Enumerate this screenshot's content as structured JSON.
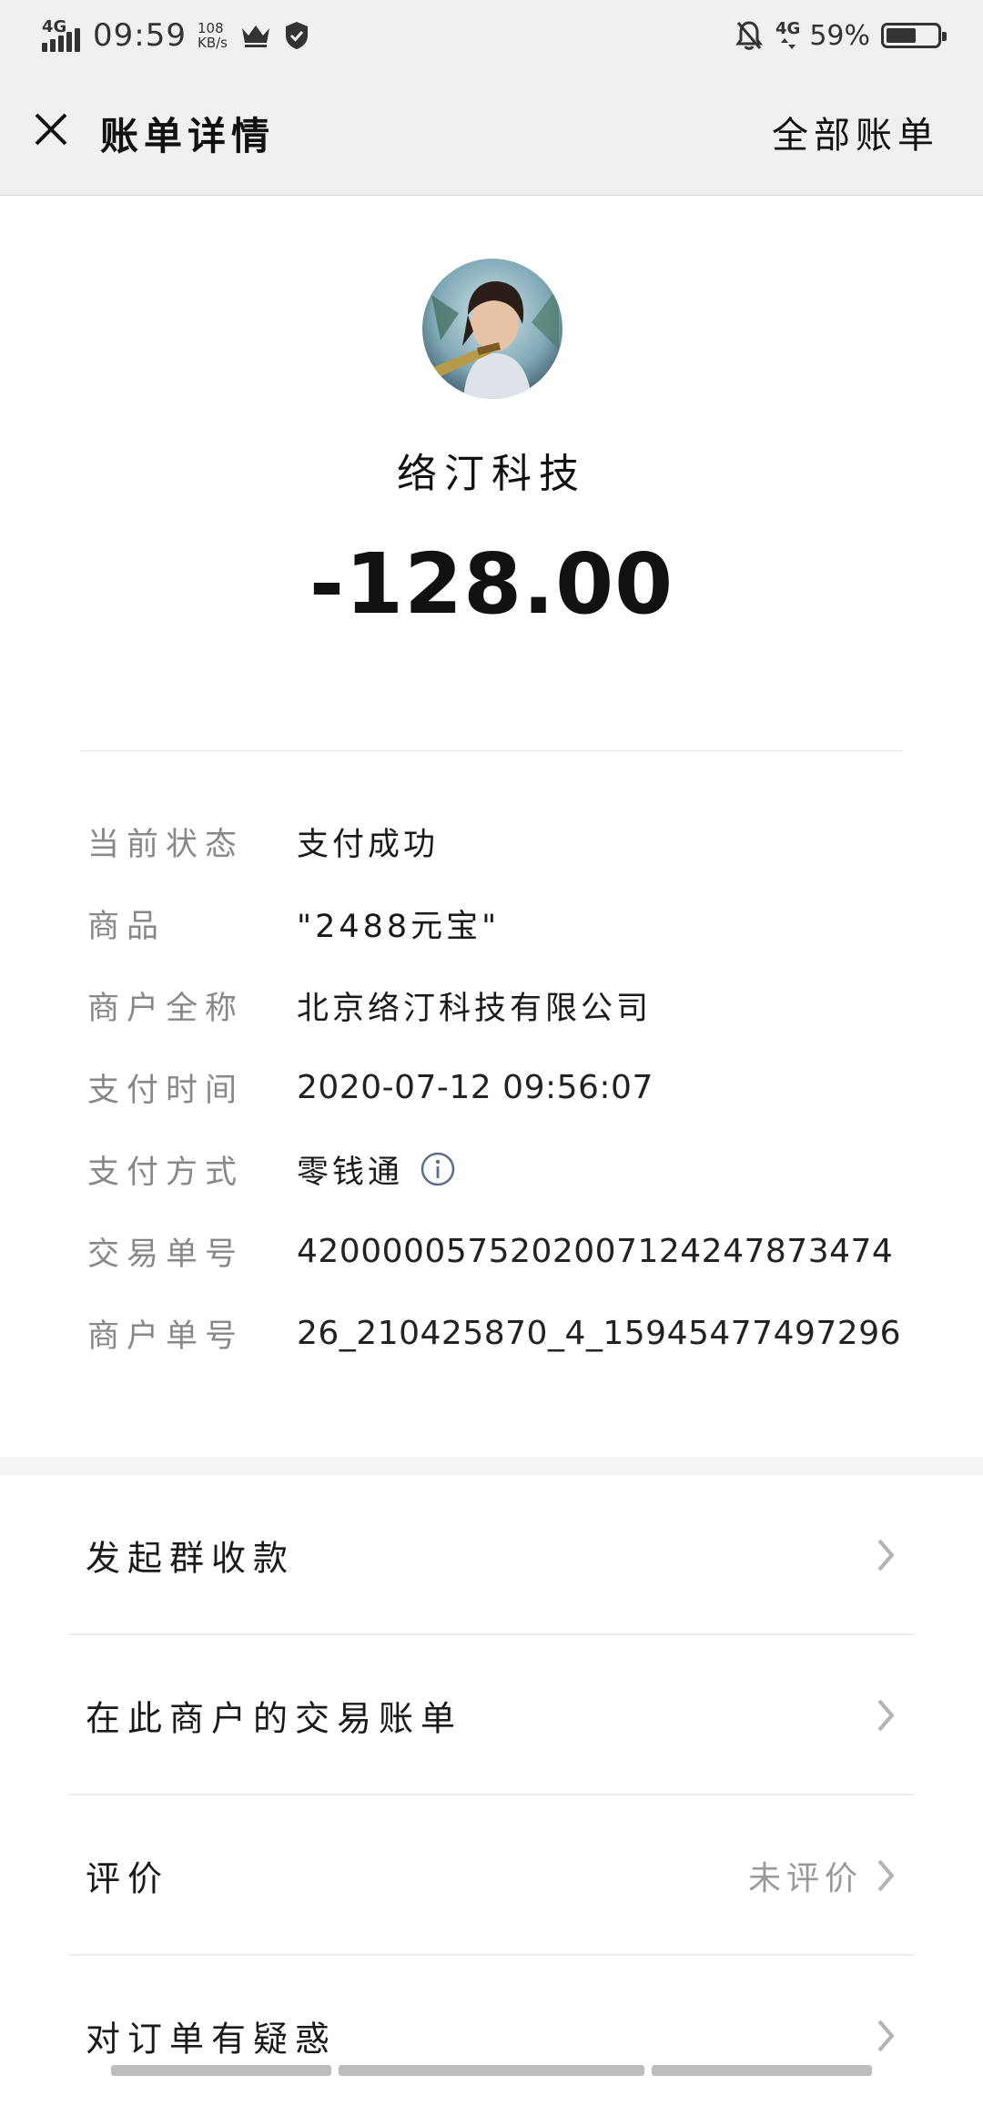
{
  "status": {
    "network_left": "4G",
    "time": "09:59",
    "speed_value": "108",
    "speed_unit": "KB/s",
    "network_right": "4G",
    "battery_percent": "59%",
    "battery_level": 0.59
  },
  "nav": {
    "title": "账单详情",
    "right_link": "全部账单"
  },
  "bill": {
    "merchant": "络汀科技",
    "amount": "-128.00"
  },
  "details": [
    {
      "label": "当前状态",
      "value": "支付成功"
    },
    {
      "label": "商品",
      "value": "\"2488元宝\""
    },
    {
      "label": "商户全称",
      "value": "北京络汀科技有限公司"
    },
    {
      "label": "支付时间",
      "value": "2020-07-12 09:56:07"
    },
    {
      "label": "支付方式",
      "value": "零钱通"
    },
    {
      "label": "交易单号",
      "value": "4200000575202007124247873474"
    },
    {
      "label": "商户单号",
      "value": "26_210425870_4_15945477497296"
    }
  ],
  "menu": [
    {
      "label": "发起群收款",
      "sub": ""
    },
    {
      "label": "在此商户的交易账单",
      "sub": ""
    },
    {
      "label": "评价",
      "sub": "未评价"
    },
    {
      "label": "对订单有疑惑",
      "sub": ""
    }
  ],
  "icons": {
    "close": "close-icon",
    "info": "info-icon",
    "chevron": "chevron-right-icon"
  }
}
